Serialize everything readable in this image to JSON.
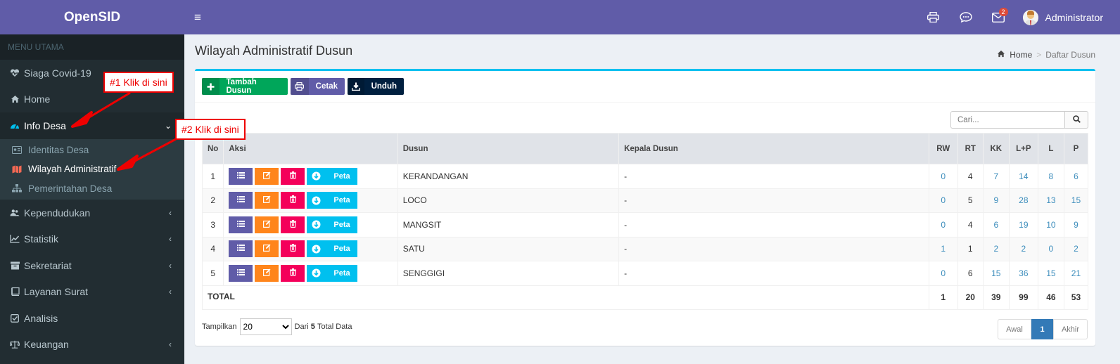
{
  "app": {
    "title": "OpenSID"
  },
  "sidebar": {
    "header": "MENU UTAMA",
    "items": [
      {
        "label": "Siaga Covid-19",
        "icon": "heartbeat-icon"
      },
      {
        "label": "Home",
        "icon": "home-icon"
      },
      {
        "label": "Info Desa",
        "icon": "dashboard-icon",
        "expanded": true
      },
      {
        "label": "Kependudukan",
        "icon": "users-icon"
      },
      {
        "label": "Statistik",
        "icon": "chart-line-icon"
      },
      {
        "label": "Sekretariat",
        "icon": "archive-icon"
      },
      {
        "label": "Layanan Surat",
        "icon": "book-icon"
      },
      {
        "label": "Analisis",
        "icon": "check-square-icon"
      },
      {
        "label": "Keuangan",
        "icon": "balance-scale-icon"
      }
    ],
    "submenu": [
      {
        "label": "Identitas Desa",
        "icon": "id-card-icon"
      },
      {
        "label": "Wilayah Administratif",
        "icon": "map-icon",
        "active": true
      },
      {
        "label": "Pemerintahan Desa",
        "icon": "sitemap-icon"
      }
    ]
  },
  "topbar": {
    "user": "Administrator",
    "mail_badge": "2"
  },
  "page": {
    "title": "Wilayah Administratif Dusun"
  },
  "breadcrumb": {
    "home": "Home",
    "current": "Daftar Dusun"
  },
  "toolbar": {
    "add": "Tambah Dusun",
    "print": "Cetak",
    "download": "Unduh"
  },
  "search": {
    "placeholder": "Cari..."
  },
  "table": {
    "headers": [
      "No",
      "Aksi",
      "Dusun",
      "Kepala Dusun",
      "RW",
      "RT",
      "KK",
      "L+P",
      "L",
      "P"
    ],
    "peta_label": "Peta",
    "rows": [
      {
        "no": "1",
        "dusun": "KERANDANGAN",
        "kepala": "-",
        "rw": "0",
        "rt": "4",
        "kk": "7",
        "lp": "14",
        "l": "8",
        "p": "6"
      },
      {
        "no": "2",
        "dusun": "LOCO",
        "kepala": "-",
        "rw": "0",
        "rt": "5",
        "kk": "9",
        "lp": "28",
        "l": "13",
        "p": "15"
      },
      {
        "no": "3",
        "dusun": "MANGSIT",
        "kepala": "-",
        "rw": "0",
        "rt": "4",
        "kk": "6",
        "lp": "19",
        "l": "10",
        "p": "9"
      },
      {
        "no": "4",
        "dusun": "SATU",
        "kepala": "-",
        "rw": "1",
        "rt": "1",
        "kk": "2",
        "lp": "2",
        "l": "0",
        "p": "2"
      },
      {
        "no": "5",
        "dusun": "SENGGIGI",
        "kepala": "-",
        "rw": "0",
        "rt": "6",
        "kk": "15",
        "lp": "36",
        "l": "15",
        "p": "21"
      }
    ],
    "total": {
      "label": "TOTAL",
      "rw": "1",
      "rt": "20",
      "kk": "39",
      "lp": "99",
      "l": "46",
      "p": "53"
    }
  },
  "footer": {
    "show_label": "Tampilkan",
    "per_page": "20",
    "from_label": "Dari",
    "total_count": "5",
    "total_label": "Total Data"
  },
  "pagination": {
    "first": "Awal",
    "current": "1",
    "last": "Akhir"
  },
  "annotations": {
    "callout1": "#1 Klik di sini",
    "callout2": "#2 Klik di sini"
  },
  "colors": {
    "brand": "#605ca8",
    "sidebar_bg": "#222d32",
    "accent": "#00c0ef",
    "callout": "#e00000"
  }
}
